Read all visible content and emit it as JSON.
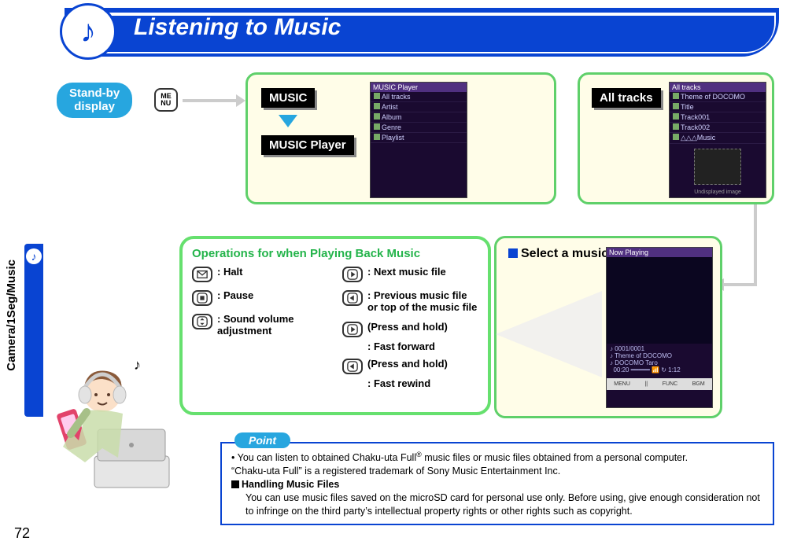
{
  "header": {
    "title": "Listening to Music"
  },
  "sidebar": {
    "label": "Camera/1Seg/Music"
  },
  "flow": {
    "standby": {
      "line1": "Stand-by",
      "line2": "display"
    },
    "menu_key": "ME\nNU",
    "music_chip": "MUSIC",
    "player_chip": "MUSIC Player",
    "alltracks_chip": "All tracks",
    "select_label": "Select a music file."
  },
  "screens": {
    "player_menu": {
      "title": "MUSIC Player",
      "items": [
        "All tracks",
        "Artist",
        "Album",
        "Genre",
        "Playlist"
      ]
    },
    "all_tracks": {
      "title": "All tracks",
      "items": [
        "Theme of DOCOMO",
        "Title",
        "Track001",
        "Track002",
        "△△△Music"
      ],
      "footer": "Undisplayed image"
    },
    "now_playing": {
      "title": "Now Playing",
      "counter": "0001/0001",
      "track": "Theme of DOCOMO",
      "artist": "DOCOMO Taro",
      "time": "00:20",
      "softkeys": [
        "MENU",
        "||",
        "FUNC",
        "BGM"
      ]
    }
  },
  "operations": {
    "title": "Operations for when Playing Back Music",
    "left": [
      {
        "key": "mail",
        "label": ": Halt"
      },
      {
        "key": "center",
        "label": ": Pause"
      },
      {
        "key": "updown",
        "label": ": Sound volume adjustment"
      }
    ],
    "right": [
      {
        "key": "right",
        "label": ": Next music file"
      },
      {
        "key": "left",
        "label": ": Previous music file or top of the music file"
      },
      {
        "key": "right",
        "hold": "(Press and hold)",
        "sub": ": Fast forward"
      },
      {
        "key": "left",
        "hold": "(Press and hold)",
        "sub": ": Fast rewind"
      }
    ]
  },
  "point": {
    "tab": "Point",
    "bullet1a": "You can listen to obtained Chaku-uta Full",
    "bullet1b": " music files or music files obtained from a personal computer.",
    "line2": "“Chaku-uta Full” is a registered trademark of Sony Music Entertainment Inc.",
    "heading": "Handling Music Files",
    "body": "You can use music files saved on the microSD card for personal use only. Before using, give enough consideration not to infringe on the third party’s intellectual property rights or other rights such as copyright."
  },
  "page_number": "72"
}
